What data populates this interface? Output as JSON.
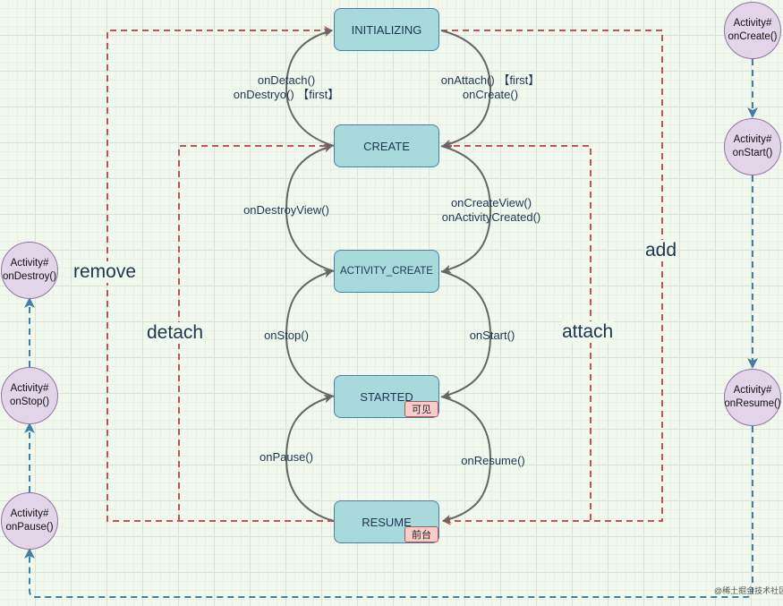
{
  "states": [
    {
      "id": "initializing",
      "label": "INITIALIZING"
    },
    {
      "id": "create",
      "label": "CREATE"
    },
    {
      "id": "activity_create",
      "label": "ACTIVITY_CREATE"
    },
    {
      "id": "started",
      "label": "STARTED",
      "badge": "可见"
    },
    {
      "id": "resume",
      "label": "RESUME",
      "badge": "前台"
    }
  ],
  "transitions_left": [
    {
      "line1": "onDetach()",
      "line2": "onDestryo() 【first】"
    },
    {
      "line1": "onDestroyView()"
    },
    {
      "line1": "onStop()"
    },
    {
      "line1": "onPause()"
    }
  ],
  "transitions_right": [
    {
      "line1": "onAttach() 【first】",
      "line2": "onCreate()"
    },
    {
      "line1": "onCreateView()",
      "line2": "onActivityCreated()"
    },
    {
      "line1": "onStart()"
    },
    {
      "line1": "onResume()"
    }
  ],
  "operations": {
    "remove": "remove",
    "detach": "detach",
    "attach": "attach",
    "add": "add"
  },
  "activity_left": [
    {
      "line1": "Activity#",
      "line2": "onDestroy()"
    },
    {
      "line1": "Activity#",
      "line2": "onStop()"
    },
    {
      "line1": "Activity#",
      "line2": "onPause()"
    }
  ],
  "activity_right": [
    {
      "line1": "Activity#",
      "line2": "onCreate()"
    },
    {
      "line1": "Activity#",
      "line2": "onStart()"
    },
    {
      "line1": "Activity#",
      "line2": "onResume()"
    }
  ],
  "watermark": "@稀土掘金技术社区",
  "colors": {
    "state_fill": "#a8dadc",
    "state_border": "#4a7fa7",
    "badge_fill": "#f8cecc",
    "activity_fill": "#e1d5e7",
    "fragment_op_line": "#c65353",
    "activity_line": "#3f7ea6",
    "transition_line": "#666666"
  }
}
